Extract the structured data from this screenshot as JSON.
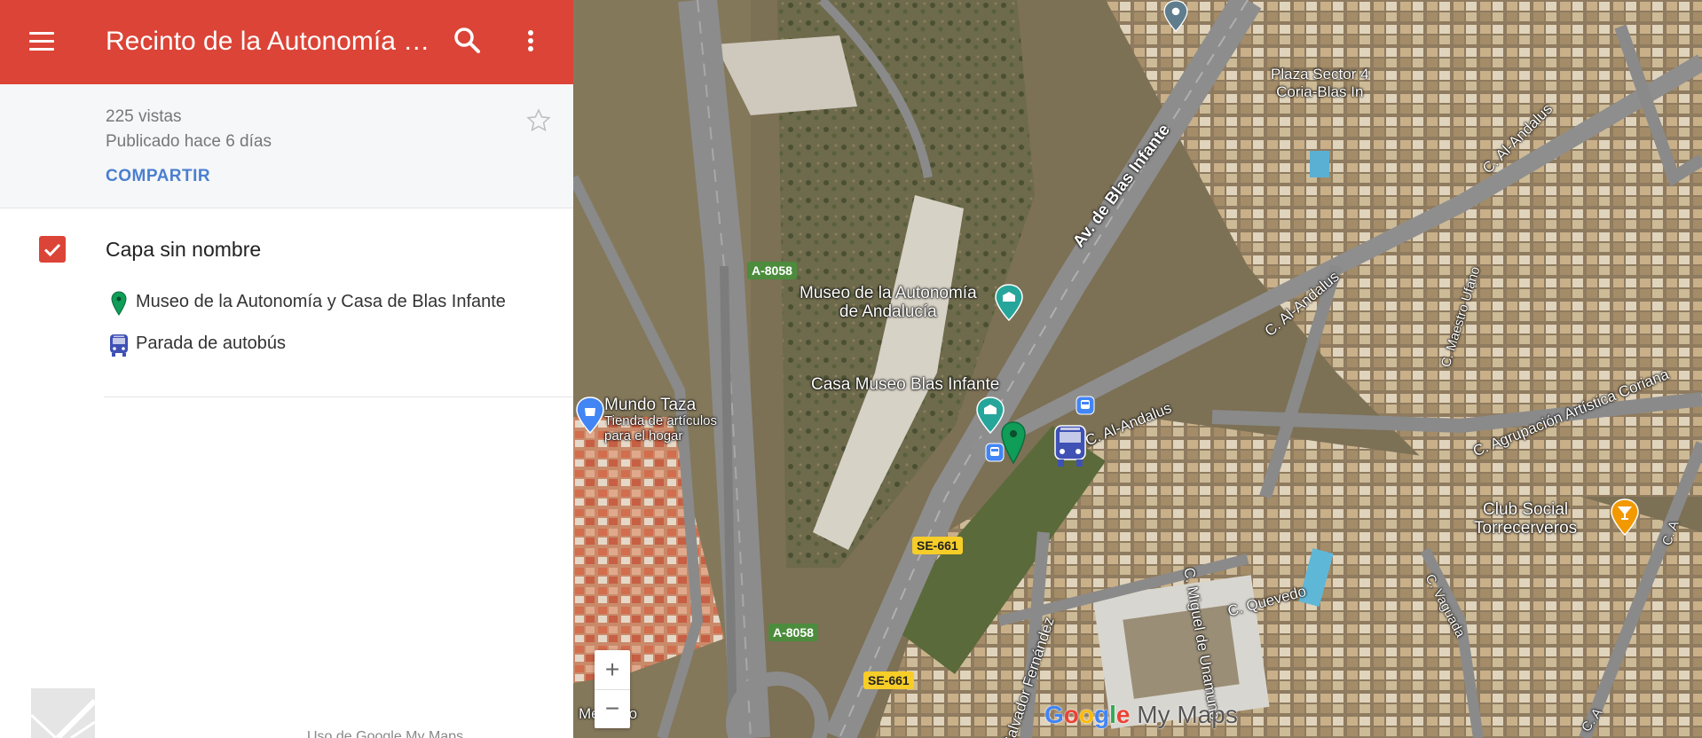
{
  "header": {
    "title": "Recinto de la Autonomía de Andalucía",
    "bg_color": "#db4437",
    "menu_icon": "hamburger-menu-icon",
    "search_icon": "search-icon",
    "more_icon": "more-vert-icon"
  },
  "info": {
    "views": "225 vistas",
    "published": "Publicado hace 6 días",
    "share_label": "COMPARTIR",
    "star_icon": "star-outline-icon"
  },
  "layer": {
    "checked": true,
    "name": "Capa sin nombre",
    "items": [
      {
        "label": "Museo de la Autonomía y Casa de Blas Infante",
        "icon": "green-marker-icon",
        "color": "#0f9d58"
      },
      {
        "label": "Parada de autobús",
        "icon": "bus-icon",
        "color": "#3f51b5"
      }
    ]
  },
  "footer": {
    "text": "Uso de Google My Maps"
  },
  "map": {
    "roads": {
      "a8058_top": "A-8058",
      "a8058_bottom": "A-8058",
      "se661_top": "SE-661",
      "se661_bottom": "SE-661"
    },
    "labels": {
      "plaza": [
        "Plaza Sector 4",
        "Coria-Blas In"
      ],
      "museo": [
        "Museo de la Autonomía",
        "de Andalucía"
      ],
      "casa": "Casa Museo Blas Infante",
      "mundo": "Mundo Taza",
      "tienda": [
        "Tienda de artículos",
        "para el hogar"
      ],
      "av_blas": "Av. de Blas Infante",
      "al_andalus_1": "C. Al-Andalus",
      "al_andalus_2": "C. Al-Andalus",
      "al_andalus_3": "C. Al-Andalus",
      "maestro": "C. Maestro Ufano",
      "agrupacion": "C. Agrupación Artística Coriana",
      "club": [
        "Club Social",
        "Torrecerveros"
      ],
      "quevedo": "C. Quevedo",
      "miguel": "C. Miguel de Unamuno",
      "salvador": "Salvador Fernández",
      "vaguada": "C. Vaguada",
      "c_a_1": "C. A",
      "c_a_2": "C. A",
      "mercado": "Mercado"
    },
    "zoom_in": "+",
    "zoom_out": "−",
    "logo": {
      "google": "Google",
      "mymaps": "My Maps"
    }
  }
}
